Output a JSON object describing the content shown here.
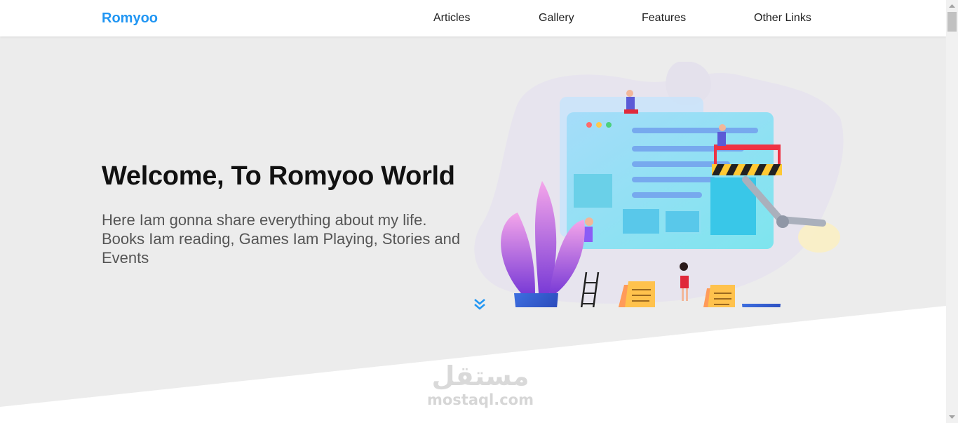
{
  "header": {
    "logo": "Romyoo",
    "nav": [
      "Articles",
      "Gallery",
      "Features",
      "Other Links"
    ]
  },
  "landing": {
    "title": "Welcome, To Romyoo World",
    "text": "Here Iam gonna share everything about my life. Books Iam reading, Games Iam Playing, Stories and Events"
  },
  "watermark": {
    "arabic": "مستقل",
    "latin": "mostaql.com"
  },
  "icons": {
    "scroll_down": "double-chevron-down-icon",
    "illustration": "web-builders-illustration"
  },
  "colors": {
    "accent": "#2196f3",
    "landing_bg": "#ececec",
    "text_dark": "#111111",
    "text_muted": "#555555"
  }
}
